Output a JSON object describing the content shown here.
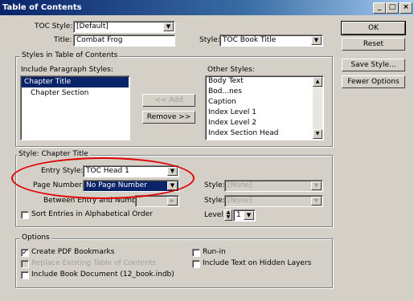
{
  "window": {
    "title": "Table of Contents",
    "minimize": "_",
    "maximize": "□",
    "close": "×"
  },
  "top": {
    "toc_style_label": "TOC Style:",
    "toc_style_value": "[Default]",
    "title_label": "Title:",
    "title_value": "Combat Frog",
    "style_label": "Style:",
    "style_value": "TOC Book Title"
  },
  "buttons": {
    "ok": "OK",
    "reset": "Reset",
    "save_style": "Save Style...",
    "fewer_options": "Fewer Options",
    "add": "<< Add",
    "remove": "Remove >>"
  },
  "styles_group": {
    "title": "Styles in Table of Contents",
    "include_label": "Include Paragraph Styles:",
    "include_items": [
      "Chapter Title",
      "Chapter Section"
    ],
    "other_label": "Other Styles:",
    "other_items": [
      "Body Text",
      "Bod...nes",
      "Caption",
      "Index Level 1",
      "Index Level 2",
      "Index Section Head"
    ]
  },
  "style_group": {
    "title": "Style: Chapter Title",
    "entry_style_label": "Entry Style:",
    "entry_style_value": "TOC Head 1",
    "page_number_label": "Page Number:",
    "page_number_value": "No Page Number",
    "page_style_label": "Style:",
    "page_style_value": "[None]",
    "between_label": "Between Entry and Number:",
    "between_value": "",
    "between_style_label": "Style:",
    "between_style_value": "[None]",
    "sort_label": "Sort Entries in Alphabetical Order",
    "level_label": "Level:",
    "level_value": "1"
  },
  "options": {
    "title": "Options",
    "create_pdf": "Create PDF Bookmarks",
    "replace_toc": "Replace Existing Table of Contents",
    "include_book": "Include Book Document (12_book.indb)",
    "run_in": "Run-in",
    "include_hidden": "Include Text on Hidden Layers"
  }
}
